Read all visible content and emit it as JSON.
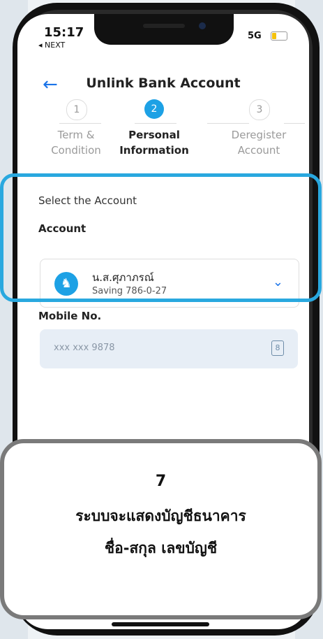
{
  "status_bar": {
    "time": "15:17",
    "back_app": "◂ NEXT",
    "network": "5G"
  },
  "header": {
    "title": "Unlink Bank Account",
    "back_icon": "left-arrow-icon"
  },
  "steps": [
    {
      "number": "1",
      "label_line1": "Term &",
      "label_line2": "Condition",
      "active": false
    },
    {
      "number": "2",
      "label_line1": "Personal",
      "label_line2": "Information",
      "active": true
    },
    {
      "number": "3",
      "label_line1": "Deregister",
      "label_line2": "Account",
      "active": false
    }
  ],
  "form": {
    "section_title": "Select the Account",
    "account_label": "Account",
    "selected_account": {
      "name": "น.ส.ศุภาภรณ์",
      "number": "Saving 786-0-27"
    },
    "mobile_label": "Mobile No.",
    "mobile_value": "xxx xxx 9878"
  },
  "caption": {
    "number": "7",
    "line1": "ระบบจะแสดงบัญชีธนาคาร",
    "line2": "ชื่อ-สกุล เลขบัญชี"
  },
  "colors": {
    "accent": "#1da1e5",
    "highlight": "#29a8df",
    "caption_border": "#7a7a7a"
  }
}
